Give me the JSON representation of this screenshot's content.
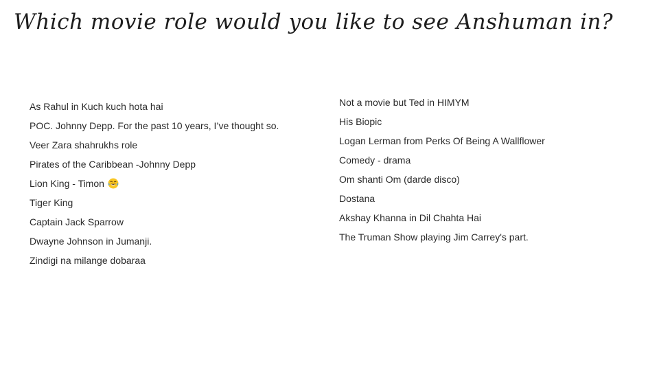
{
  "slide": {
    "title": "Which movie role would you like to see Anshuman in?"
  },
  "responses": {
    "left": [
      "As Rahul in Kuch kuch hota hai",
      "POC. Johnny Depp. For the past 10 years, I’ve thought so.",
      "Veer Zara shahrukhs role",
      "Pirates of the Caribbean -Johnny Depp",
      "Lion King - Timon",
      "Tiger King",
      "Captain Jack Sparrow",
      "Dwayne Johnson in Jumanji.",
      "Zindigi na milange dobaraa"
    ],
    "right": [
      "Not a movie but Ted in HIMYM",
      "His Biopic",
      "Logan Lerman from Perks Of Being A Wallflower",
      "Comedy - drama",
      "Om shanti Om (darde disco)",
      "Dostana",
      "Akshay Khanna in Dil Chahta Hai",
      "The Truman Show playing Jim Carrey's part."
    ]
  },
  "icons": {
    "laughing_emoji": "face-with-tears-of-joy-icon"
  },
  "colors": {
    "background": "#ffffff",
    "title_text": "#1e1e1e",
    "body_text": "#2a2a2a",
    "emoji_face": "#f9c623",
    "emoji_tears": "#4aa3e8"
  }
}
